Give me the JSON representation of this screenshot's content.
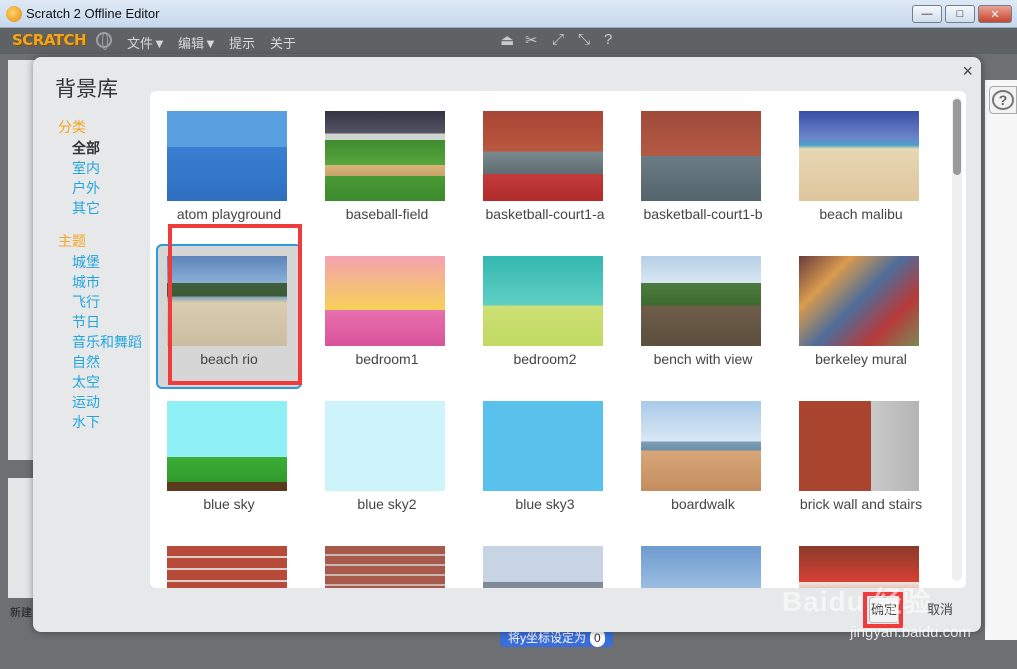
{
  "window": {
    "title": "Scratch 2 Offline Editor",
    "minimize": "—",
    "maximize": "□",
    "close": "✕"
  },
  "menubar": {
    "logo": "SCRATCH",
    "items": [
      "文件▼",
      "编辑▼",
      "提示",
      "关于"
    ],
    "tools": [
      "stamp-icon",
      "cut-icon",
      "grow-icon",
      "shrink-icon",
      "help-icon"
    ]
  },
  "modal": {
    "title": "背景库",
    "close": "×",
    "ok": "确定",
    "cancel": "取消"
  },
  "sidebar": {
    "category_heading": "分类",
    "categories": [
      "全部",
      "室内",
      "户外",
      "其它"
    ],
    "theme_heading": "主题",
    "themes": [
      "城堡",
      "城市",
      "飞行",
      "节日",
      "音乐和舞蹈",
      "自然",
      "太空",
      "运动",
      "水下"
    ]
  },
  "library": {
    "items": [
      {
        "label": "atom playground",
        "art": "playground"
      },
      {
        "label": "baseball-field",
        "art": "baseball"
      },
      {
        "label": "basketball-court1-a",
        "art": "court-a"
      },
      {
        "label": "basketball-court1-b",
        "art": "court-b"
      },
      {
        "label": "beach malibu",
        "art": "malibu"
      },
      {
        "label": "beach rio",
        "art": "rio",
        "selected": true
      },
      {
        "label": "bedroom1",
        "art": "bedroom1"
      },
      {
        "label": "bedroom2",
        "art": "bedroom2"
      },
      {
        "label": "bench with view",
        "art": "bench"
      },
      {
        "label": "berkeley mural",
        "art": "mural"
      },
      {
        "label": "blue sky",
        "art": "bluesky"
      },
      {
        "label": "blue sky2",
        "art": "bluesky2"
      },
      {
        "label": "blue sky3",
        "art": "bluesky3"
      },
      {
        "label": "boardwalk",
        "art": "boardwalk"
      },
      {
        "label": "brick wall and stairs",
        "art": "stairs"
      },
      {
        "label": "",
        "art": "brick"
      },
      {
        "label": "",
        "art": "brick2"
      },
      {
        "label": "",
        "art": "building"
      },
      {
        "label": "",
        "art": "sky4"
      },
      {
        "label": "",
        "art": "castle"
      }
    ]
  },
  "background_ui": {
    "chip_text": "将y坐标设定为",
    "chip_value": "0",
    "new_label": "新建"
  },
  "watermark": {
    "brand": "Baidu 经验",
    "url": "jingyan.baidu.com"
  }
}
